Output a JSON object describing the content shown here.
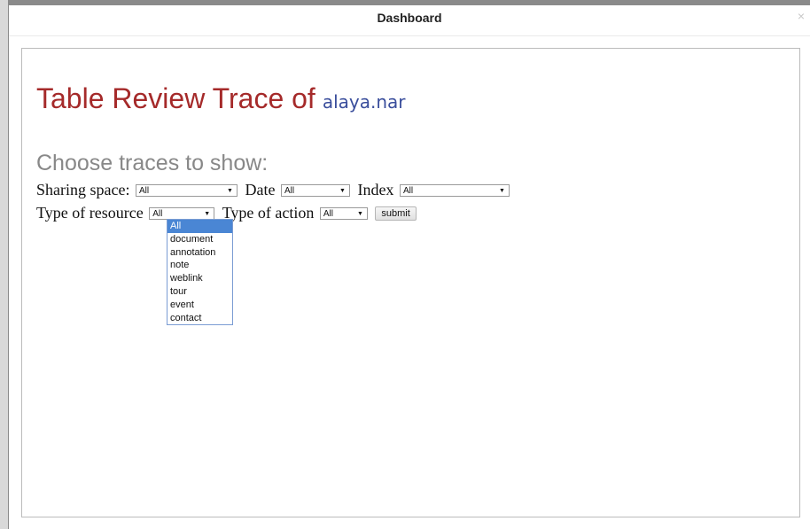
{
  "window": {
    "title": "Dashboard",
    "close_glyph": "×"
  },
  "heading": {
    "prefix": "Table Review Trace of",
    "username": "alaya.nar"
  },
  "subheading": "Choose traces to show:",
  "filters": {
    "sharing_space": {
      "label": "Sharing space:",
      "value": "All"
    },
    "date": {
      "label": "Date",
      "value": "All"
    },
    "index": {
      "label": "Index",
      "value": "All"
    },
    "type_of_resource": {
      "label": "Type of resource",
      "value": "All"
    },
    "type_of_action": {
      "label": "Type of action",
      "value": "All"
    },
    "submit_label": "submit"
  },
  "resource_options": [
    "All",
    "document",
    "annotation",
    "note",
    "weblink",
    "tour",
    "event",
    "contact"
  ],
  "colors": {
    "title": "#a52a2a",
    "username": "#3a4e9c",
    "subheading": "#888888",
    "selected_option": "#4a86d4"
  }
}
